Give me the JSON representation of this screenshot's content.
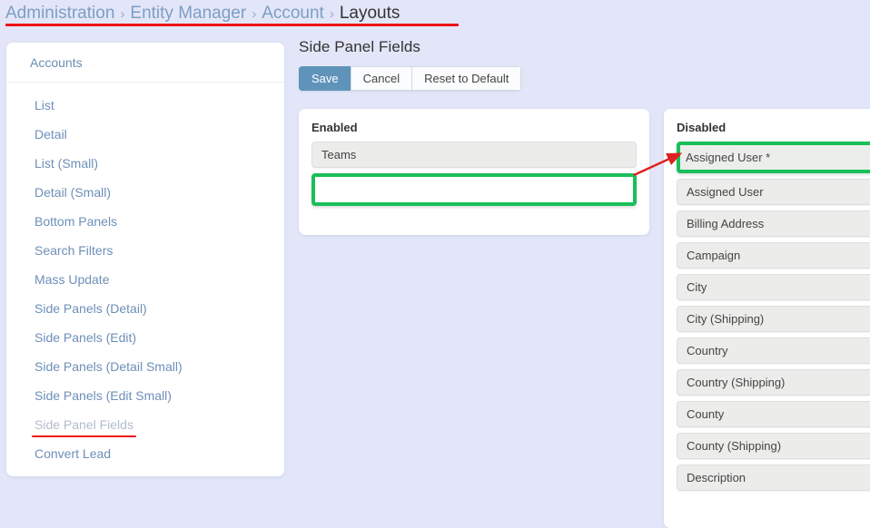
{
  "breadcrumb": {
    "items": [
      {
        "label": "Administration",
        "current": false
      },
      {
        "label": "Entity Manager",
        "current": false
      },
      {
        "label": "Account",
        "current": false
      },
      {
        "label": "Layouts",
        "current": true
      }
    ],
    "separator": "›"
  },
  "sidebar": {
    "header": "Accounts",
    "items": [
      {
        "label": "List",
        "active": false
      },
      {
        "label": "Detail",
        "active": false
      },
      {
        "label": "List (Small)",
        "active": false
      },
      {
        "label": "Detail (Small)",
        "active": false
      },
      {
        "label": "Bottom Panels",
        "active": false
      },
      {
        "label": "Search Filters",
        "active": false
      },
      {
        "label": "Mass Update",
        "active": false
      },
      {
        "label": "Side Panels (Detail)",
        "active": false
      },
      {
        "label": "Side Panels (Edit)",
        "active": false
      },
      {
        "label": "Side Panels (Detail Small)",
        "active": false
      },
      {
        "label": "Side Panels (Edit Small)",
        "active": false
      },
      {
        "label": "Side Panel Fields",
        "active": true
      },
      {
        "label": "Convert Lead",
        "active": false
      }
    ]
  },
  "main": {
    "title": "Side Panel Fields",
    "buttons": {
      "save": "Save",
      "cancel": "Cancel",
      "reset": "Reset to Default"
    },
    "enabled_panel": {
      "label": "Enabled",
      "fields": [
        "Teams"
      ],
      "dropzone_empty": true
    },
    "disabled_panel": {
      "label": "Disabled",
      "highlighted_field": "Assigned User *",
      "fields": [
        "Assigned User",
        "Billing Address",
        "Campaign",
        "City",
        "City (Shipping)",
        "Country",
        "Country (Shipping)",
        "County",
        "County (Shipping)",
        "Description"
      ]
    }
  },
  "annotations": {
    "highlight_color": "#19bf58",
    "underline_color": "#ee1111",
    "arrow_color": "#e02020"
  }
}
